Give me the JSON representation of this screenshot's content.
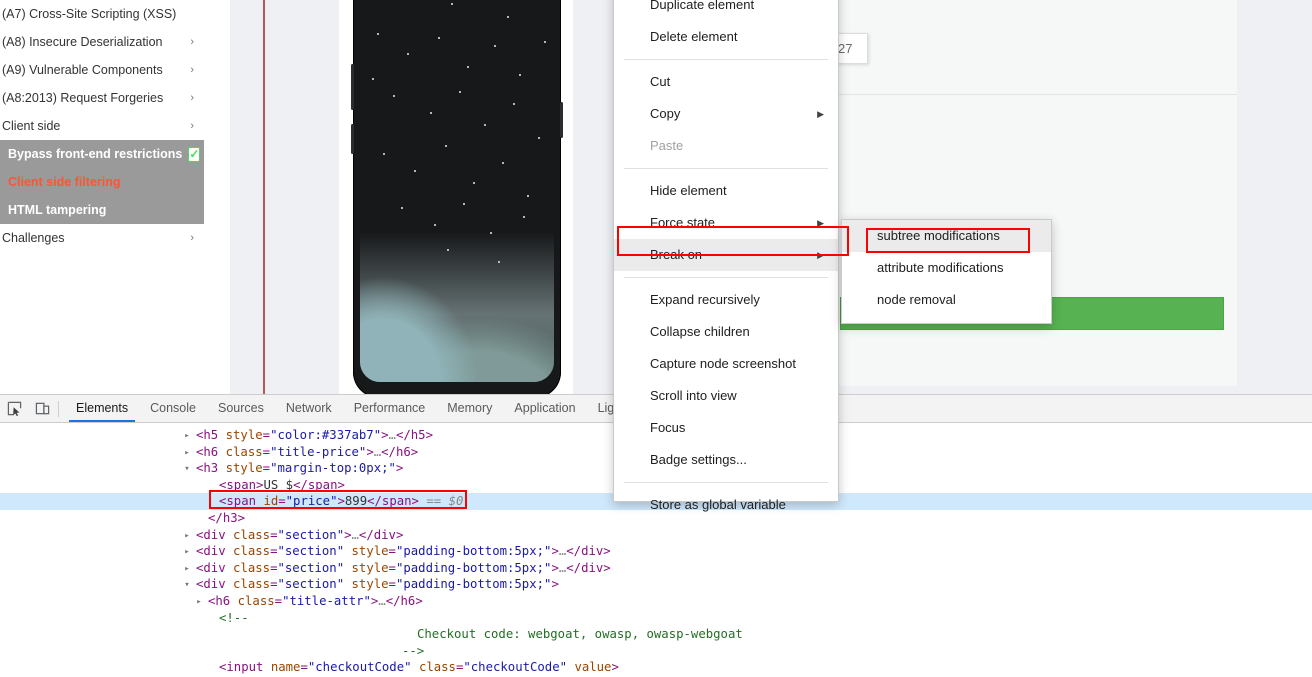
{
  "sidebar": {
    "items": [
      {
        "label": "(A7) Cross-Site Scripting (XSS)",
        "caret": "›",
        "has_caret": false
      },
      {
        "label": "(A8) Insecure Deserialization",
        "caret": "›",
        "has_caret": true
      },
      {
        "label": "(A9) Vulnerable Components",
        "caret": "›",
        "has_caret": true
      },
      {
        "label": "(A8:2013) Request Forgeries",
        "caret": "›",
        "has_caret": true
      },
      {
        "label": "Client side",
        "caret": "›",
        "has_caret": true
      }
    ],
    "sub_items": [
      {
        "label": "Bypass front-end restrictions",
        "state": "complete",
        "check": "✓"
      },
      {
        "label": "Client side filtering",
        "state": "current"
      },
      {
        "label": "HTML tampering",
        "state": "normal"
      }
    ],
    "last_item": {
      "label": "Challenges",
      "caret": "›"
    }
  },
  "product": {
    "quantity_value": "27",
    "buy_button_label": "",
    "accent_green": "#57b352"
  },
  "devtools": {
    "toolbar": {
      "inspect_icon": "inspect-element-icon",
      "device_icon": "device-toolbar-icon"
    },
    "tabs": [
      {
        "label": "Elements",
        "active": true
      },
      {
        "label": "Console",
        "active": false
      },
      {
        "label": "Sources",
        "active": false
      },
      {
        "label": "Network",
        "active": false
      },
      {
        "label": "Performance",
        "active": false
      },
      {
        "label": "Memory",
        "active": false
      },
      {
        "label": "Application",
        "active": false
      },
      {
        "label": "Lighth",
        "active": false
      }
    ],
    "dom_rows": [
      {
        "indent": 196,
        "arrow": "▸",
        "selected": false,
        "parts": [
          {
            "t": "punct",
            "v": "<"
          },
          {
            "t": "tag",
            "v": "h5"
          },
          {
            "t": "txt",
            "v": " "
          },
          {
            "t": "attr",
            "v": "style"
          },
          {
            "t": "punct",
            "v": "="
          },
          {
            "t": "val",
            "v": "\"color:#337ab7\""
          },
          {
            "t": "punct",
            "v": ">"
          },
          {
            "t": "ellip",
            "v": "…"
          },
          {
            "t": "punct",
            "v": "</"
          },
          {
            "t": "tag",
            "v": "h5"
          },
          {
            "t": "punct",
            "v": ">"
          }
        ]
      },
      {
        "indent": 196,
        "arrow": "▸",
        "selected": false,
        "parts": [
          {
            "t": "punct",
            "v": "<"
          },
          {
            "t": "tag",
            "v": "h6"
          },
          {
            "t": "txt",
            "v": " "
          },
          {
            "t": "attr",
            "v": "class"
          },
          {
            "t": "punct",
            "v": "="
          },
          {
            "t": "val",
            "v": "\"title-price\""
          },
          {
            "t": "punct",
            "v": ">"
          },
          {
            "t": "ellip",
            "v": "…"
          },
          {
            "t": "punct",
            "v": "</"
          },
          {
            "t": "tag",
            "v": "h6"
          },
          {
            "t": "punct",
            "v": ">"
          }
        ]
      },
      {
        "indent": 196,
        "arrow": "▾",
        "selected": false,
        "parts": [
          {
            "t": "punct",
            "v": "<"
          },
          {
            "t": "tag",
            "v": "h3"
          },
          {
            "t": "txt",
            "v": " "
          },
          {
            "t": "attr",
            "v": "style"
          },
          {
            "t": "punct",
            "v": "="
          },
          {
            "t": "val",
            "v": "\"margin-top:0px;\""
          },
          {
            "t": "punct",
            "v": ">"
          }
        ]
      },
      {
        "indent": 219,
        "arrow": "",
        "selected": false,
        "parts": [
          {
            "t": "punct",
            "v": "<"
          },
          {
            "t": "tag",
            "v": "span"
          },
          {
            "t": "punct",
            "v": ">"
          },
          {
            "t": "txt",
            "v": "US $"
          },
          {
            "t": "punct",
            "v": "</"
          },
          {
            "t": "tag",
            "v": "span"
          },
          {
            "t": "punct",
            "v": ">"
          }
        ]
      },
      {
        "indent": 219,
        "arrow": "",
        "selected": true,
        "parts": [
          {
            "t": "punct",
            "v": "<"
          },
          {
            "t": "tag",
            "v": "span"
          },
          {
            "t": "txt",
            "v": " "
          },
          {
            "t": "attr",
            "v": "id"
          },
          {
            "t": "punct",
            "v": "="
          },
          {
            "t": "val",
            "v": "\"price\""
          },
          {
            "t": "punct",
            "v": ">"
          },
          {
            "t": "txt",
            "v": "899"
          },
          {
            "t": "punct",
            "v": "</"
          },
          {
            "t": "tag",
            "v": "span"
          },
          {
            "t": "punct",
            "v": ">"
          },
          {
            "t": "refvar",
            "v": " == $0"
          }
        ]
      },
      {
        "indent": 208,
        "arrow": "",
        "selected": false,
        "parts": [
          {
            "t": "punct",
            "v": "</"
          },
          {
            "t": "tag",
            "v": "h3"
          },
          {
            "t": "punct",
            "v": ">"
          }
        ]
      },
      {
        "indent": 196,
        "arrow": "▸",
        "selected": false,
        "parts": [
          {
            "t": "punct",
            "v": "<"
          },
          {
            "t": "tag",
            "v": "div"
          },
          {
            "t": "txt",
            "v": " "
          },
          {
            "t": "attr",
            "v": "class"
          },
          {
            "t": "punct",
            "v": "="
          },
          {
            "t": "val",
            "v": "\"section\""
          },
          {
            "t": "punct",
            "v": ">"
          },
          {
            "t": "ellip",
            "v": "…"
          },
          {
            "t": "punct",
            "v": "</"
          },
          {
            "t": "tag",
            "v": "div"
          },
          {
            "t": "punct",
            "v": ">"
          }
        ]
      },
      {
        "indent": 196,
        "arrow": "▸",
        "selected": false,
        "parts": [
          {
            "t": "punct",
            "v": "<"
          },
          {
            "t": "tag",
            "v": "div"
          },
          {
            "t": "txt",
            "v": " "
          },
          {
            "t": "attr",
            "v": "class"
          },
          {
            "t": "punct",
            "v": "="
          },
          {
            "t": "val",
            "v": "\"section\""
          },
          {
            "t": "txt",
            "v": " "
          },
          {
            "t": "attr",
            "v": "style"
          },
          {
            "t": "punct",
            "v": "="
          },
          {
            "t": "val",
            "v": "\"padding-bottom:5px;\""
          },
          {
            "t": "punct",
            "v": ">"
          },
          {
            "t": "ellip",
            "v": "…"
          },
          {
            "t": "punct",
            "v": "</"
          },
          {
            "t": "tag",
            "v": "div"
          },
          {
            "t": "punct",
            "v": ">"
          }
        ]
      },
      {
        "indent": 196,
        "arrow": "▸",
        "selected": false,
        "parts": [
          {
            "t": "punct",
            "v": "<"
          },
          {
            "t": "tag",
            "v": "div"
          },
          {
            "t": "txt",
            "v": " "
          },
          {
            "t": "attr",
            "v": "class"
          },
          {
            "t": "punct",
            "v": "="
          },
          {
            "t": "val",
            "v": "\"section\""
          },
          {
            "t": "txt",
            "v": " "
          },
          {
            "t": "attr",
            "v": "style"
          },
          {
            "t": "punct",
            "v": "="
          },
          {
            "t": "val",
            "v": "\"padding-bottom:5px;\""
          },
          {
            "t": "punct",
            "v": ">"
          },
          {
            "t": "ellip",
            "v": "…"
          },
          {
            "t": "punct",
            "v": "</"
          },
          {
            "t": "tag",
            "v": "div"
          },
          {
            "t": "punct",
            "v": ">"
          }
        ]
      },
      {
        "indent": 196,
        "arrow": "▾",
        "selected": false,
        "parts": [
          {
            "t": "punct",
            "v": "<"
          },
          {
            "t": "tag",
            "v": "div"
          },
          {
            "t": "txt",
            "v": " "
          },
          {
            "t": "attr",
            "v": "class"
          },
          {
            "t": "punct",
            "v": "="
          },
          {
            "t": "val",
            "v": "\"section\""
          },
          {
            "t": "txt",
            "v": " "
          },
          {
            "t": "attr",
            "v": "style"
          },
          {
            "t": "punct",
            "v": "="
          },
          {
            "t": "val",
            "v": "\"padding-bottom:5px;\""
          },
          {
            "t": "punct",
            "v": ">"
          }
        ]
      },
      {
        "indent": 208,
        "arrow": "▸",
        "selected": false,
        "parts": [
          {
            "t": "punct",
            "v": "<"
          },
          {
            "t": "tag",
            "v": "h6"
          },
          {
            "t": "txt",
            "v": " "
          },
          {
            "t": "attr",
            "v": "class"
          },
          {
            "t": "punct",
            "v": "="
          },
          {
            "t": "val",
            "v": "\"title-attr\""
          },
          {
            "t": "punct",
            "v": ">"
          },
          {
            "t": "ellip",
            "v": "…"
          },
          {
            "t": "punct",
            "v": "</"
          },
          {
            "t": "tag",
            "v": "h6"
          },
          {
            "t": "punct",
            "v": ">"
          }
        ]
      },
      {
        "indent": 219,
        "arrow": "",
        "selected": false,
        "parts": [
          {
            "t": "comment",
            "v": "<!--"
          }
        ]
      },
      {
        "indent": 417,
        "arrow": "",
        "selected": false,
        "parts": [
          {
            "t": "comment",
            "v": "Checkout code: webgoat, owasp, owasp-webgoat"
          }
        ]
      },
      {
        "indent": 402,
        "arrow": "",
        "selected": false,
        "parts": [
          {
            "t": "comment",
            "v": "-->"
          }
        ]
      },
      {
        "indent": 219,
        "arrow": "",
        "selected": false,
        "parts": [
          {
            "t": "punct",
            "v": "<"
          },
          {
            "t": "tag",
            "v": "input"
          },
          {
            "t": "txt",
            "v": " "
          },
          {
            "t": "attr",
            "v": "name"
          },
          {
            "t": "punct",
            "v": "="
          },
          {
            "t": "val",
            "v": "\"checkoutCode\""
          },
          {
            "t": "txt",
            "v": " "
          },
          {
            "t": "attr",
            "v": "class"
          },
          {
            "t": "punct",
            "v": "="
          },
          {
            "t": "val",
            "v": "\"checkoutCode\""
          },
          {
            "t": "txt",
            "v": " "
          },
          {
            "t": "attr",
            "v": "value"
          },
          {
            "t": "punct",
            "v": ">"
          }
        ]
      }
    ]
  },
  "context_menu": {
    "items": [
      {
        "label": "Duplicate element",
        "type": "item"
      },
      {
        "label": "Delete element",
        "type": "item"
      },
      {
        "type": "divider"
      },
      {
        "label": "Cut",
        "type": "item"
      },
      {
        "label": "Copy",
        "type": "item",
        "submenu": true
      },
      {
        "label": "Paste",
        "type": "item",
        "disabled": true
      },
      {
        "type": "divider"
      },
      {
        "label": "Hide element",
        "type": "item"
      },
      {
        "label": "Force state",
        "type": "item",
        "submenu": true
      },
      {
        "label": "Break on",
        "type": "item",
        "submenu": true,
        "hover": true,
        "annotated": true
      },
      {
        "type": "divider"
      },
      {
        "label": "Expand recursively",
        "type": "item"
      },
      {
        "label": "Collapse children",
        "type": "item"
      },
      {
        "label": "Capture node screenshot",
        "type": "item"
      },
      {
        "label": "Scroll into view",
        "type": "item"
      },
      {
        "label": "Focus",
        "type": "item"
      },
      {
        "label": "Badge settings...",
        "type": "item"
      },
      {
        "type": "divider"
      },
      {
        "label": "Store as global variable",
        "type": "item"
      }
    ],
    "submenu": {
      "items": [
        {
          "label": "subtree modifications",
          "hover": true,
          "annotated": true
        },
        {
          "label": "attribute modifications",
          "hover": false
        },
        {
          "label": "node removal",
          "hover": false
        }
      ]
    },
    "submenu_arrow": "▶"
  },
  "colors": {
    "annotation_red": "#ff0000",
    "selection_blue": "#cfe8fc",
    "tab_accent": "#1a73e8",
    "sidebar_highlight": "#9a9a9a"
  }
}
